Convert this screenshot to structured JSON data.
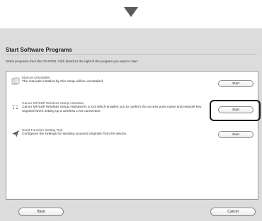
{
  "header": {
    "arrow_icon": "down-arrow-icon"
  },
  "dialog": {
    "title": "Start Software Programs",
    "subtitle": "Starts programs from the CD-ROM. Click [Start] to the right of the program you want to start."
  },
  "programs": [
    {
      "name": "Manual Uninstaller",
      "description": "The manuals installed by this setup will be uninstalled.",
      "button": "Start",
      "icon": "uninstaller-icon"
    },
    {
      "name": "Canon MF/LBP Wireless Setup Assistant",
      "description": "Canon MF/LBP Wireless Setup Assistant is a tool which enables you to confirm the access point name and network key required when setting up a wireless LAN connection.",
      "button": "Start",
      "icon": "wireless-icon"
    },
    {
      "name": "Send Function Setting Tool",
      "description": "Configures the settings for sending scanned originals from the device.",
      "button": "Start",
      "icon": "send-function-icon"
    }
  ],
  "footer": {
    "back_label": "Back",
    "cancel_label": "Cancel"
  },
  "colors": {
    "dialog_bg": "#dcdcdc",
    "highlight": "#1a1a1a"
  }
}
